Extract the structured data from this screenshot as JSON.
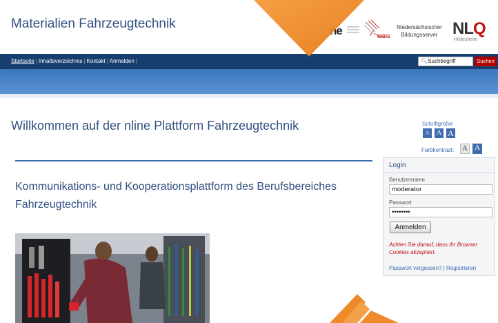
{
  "header": {
    "site_title": "Materialien Fahrzeugtechnik",
    "logo_fragment": "ne",
    "nibis_label": "NiBiS",
    "bildungsserver_line1": "Niedersächsischer",
    "bildungsserver_line2": "Bildungsserver",
    "nlq_n_l": "NL",
    "nlq_q": "Q",
    "nlq_sub": "Hildesheim"
  },
  "nav": {
    "items": [
      "Startseite",
      "Inhaltsverzeichnis",
      "Kontakt",
      "Anmelden"
    ],
    "search_placeholder": "Suchbegriff",
    "search_button": "Suchen"
  },
  "main": {
    "welcome": "Willkommen auf der nline Plattform Fahrzeugtechnik",
    "headline": "Kommunikations- und Kooperationsplattform des Berufsbereiches Fahrzeugtechnik"
  },
  "accessibility": {
    "font_size_label": "Schriftgröße:",
    "font_size_buttons": [
      "A",
      "A",
      "A"
    ],
    "contrast_label": "Farbkontrast:",
    "contrast_buttons": [
      "A",
      "A"
    ]
  },
  "login": {
    "title": "Login",
    "username_label": "Benutzername",
    "username_value": "moderator",
    "password_label": "Passwort",
    "password_value": "••••••••",
    "submit": "Anmelden",
    "warning": "Achten Sie darauf, dass Ihr Browser Cookies akzeptiert.",
    "forgot": "Passwort vergessen?",
    "separator": "|",
    "register": "Registrieren"
  },
  "colors": {
    "nav_bg": "#163e6e",
    "band": "#4a86c8",
    "title": "#2f4f7f",
    "accent": "#3d6cb0",
    "warning": "#c01010",
    "arrow": "#ef8a2a"
  }
}
